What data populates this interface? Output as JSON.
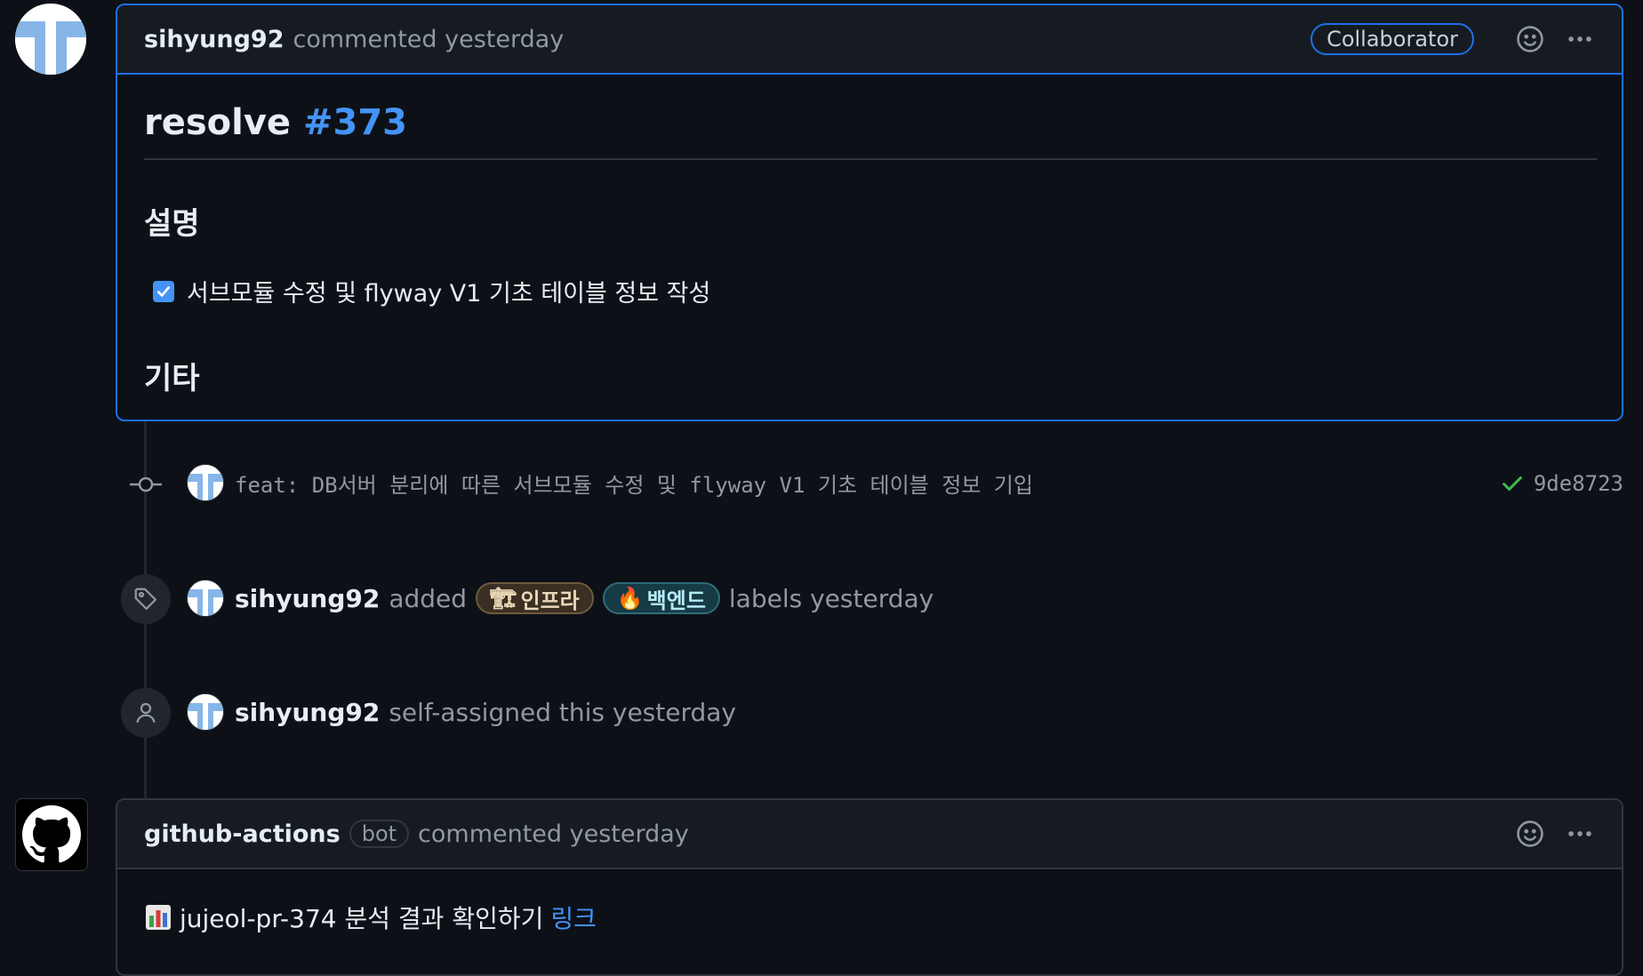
{
  "first_comment": {
    "author": "sihyung92",
    "action": "commented yesterday",
    "badge": "Collaborator",
    "title_prefix": "resolve",
    "title_link": "#373",
    "section_description": "설명",
    "task_item": "서브모듈 수정 및 flyway V1 기초 테이블 정보 작성",
    "task_checked": true,
    "section_other": "기타"
  },
  "commit": {
    "message": "feat: DB서버 분리에 따른 서브모듈 수정 및 flyway V1 기초 테이블 정보 기입",
    "sha": "9de8723",
    "status": "success"
  },
  "label_event": {
    "actor": "sihyung92",
    "verb": "added",
    "labels": [
      {
        "emoji": "🏗",
        "text": "인프라"
      },
      {
        "emoji": "🔥",
        "text": "백엔드"
      }
    ],
    "suffix": "labels yesterday"
  },
  "assign_event": {
    "actor": "sihyung92",
    "text": "self-assigned this yesterday"
  },
  "bot_comment": {
    "author": "github-actions",
    "badge": "bot",
    "action": "commented yesterday",
    "body_text": "jujeol-pr-374 분석 결과 확인하기",
    "link_text": "링크"
  },
  "icons": {
    "avatar": "identicon-avatar",
    "emoji_reaction": "smiley-icon",
    "more_menu": "kebab-horizontal-icon",
    "commit": "git-commit-icon",
    "check": "check-icon",
    "label": "tag-icon",
    "assign": "person-icon",
    "bot_avatar": "github-mark-icon",
    "chart": "bar-chart-icon"
  },
  "colors": {
    "background": "#0d1117",
    "accent": "#1f6feb",
    "link": "#4493f8",
    "success": "#3fb950"
  }
}
